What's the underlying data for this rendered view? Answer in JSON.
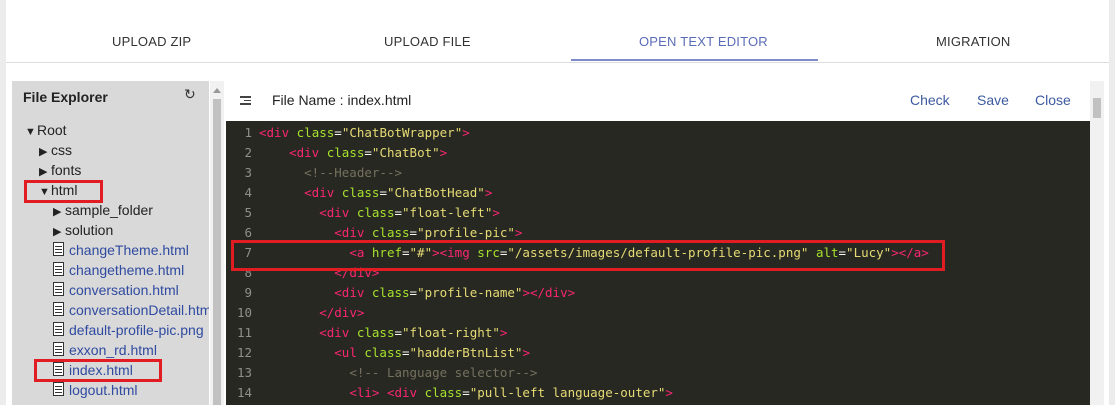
{
  "tabs": [
    {
      "label": "UPLOAD ZIP"
    },
    {
      "label": "UPLOAD FILE"
    },
    {
      "label": "OPEN TEXT EDITOR",
      "active": true
    },
    {
      "label": "MIGRATION"
    }
  ],
  "explorer": {
    "title": "File Explorer",
    "refresh_icon": "refresh-icon",
    "tree": [
      {
        "label": "Root",
        "type": "folder",
        "expanded": true
      },
      {
        "label": "css",
        "type": "folder"
      },
      {
        "label": "fonts",
        "type": "folder"
      },
      {
        "label": "html",
        "type": "folder",
        "expanded": true,
        "highlighted": true
      },
      {
        "label": "sample_folder",
        "type": "folder"
      },
      {
        "label": "solution",
        "type": "folder"
      },
      {
        "label": "changeTheme.html",
        "type": "file"
      },
      {
        "label": "changetheme.html",
        "type": "file"
      },
      {
        "label": "conversation.html",
        "type": "file"
      },
      {
        "label": "conversationDetail.htm",
        "type": "file"
      },
      {
        "label": "default-profile-pic.png",
        "type": "file"
      },
      {
        "label": "exxon_rd.html",
        "type": "file"
      },
      {
        "label": "index.html",
        "type": "file",
        "highlighted": true
      },
      {
        "label": "logout.html",
        "type": "file"
      }
    ]
  },
  "editor": {
    "file_label": "File Name :  index.html",
    "check": "Check",
    "save": "Save",
    "close": "Close",
    "lines": [
      {
        "n": "1",
        "ind": "",
        "parts": [
          [
            "tg",
            "<div "
          ],
          [
            "at",
            "class"
          ],
          [
            "pu",
            "="
          ],
          [
            "st",
            "\"ChatBotWrapper\""
          ],
          [
            "tg",
            ">"
          ]
        ]
      },
      {
        "n": "2",
        "ind": "    ",
        "parts": [
          [
            "tg",
            "<div "
          ],
          [
            "at",
            "class"
          ],
          [
            "pu",
            "="
          ],
          [
            "st",
            "\"ChatBot\""
          ],
          [
            "tg",
            ">"
          ]
        ]
      },
      {
        "n": "3",
        "ind": "      ",
        "parts": [
          [
            "cm",
            "<!--Header-->"
          ]
        ]
      },
      {
        "n": "4",
        "ind": "      ",
        "parts": [
          [
            "tg",
            "<div "
          ],
          [
            "at",
            "class"
          ],
          [
            "pu",
            "="
          ],
          [
            "st",
            "\"ChatBotHead\""
          ],
          [
            "tg",
            ">"
          ]
        ]
      },
      {
        "n": "5",
        "ind": "        ",
        "parts": [
          [
            "tg",
            "<div "
          ],
          [
            "at",
            "class"
          ],
          [
            "pu",
            "="
          ],
          [
            "st",
            "\"float-left\""
          ],
          [
            "tg",
            ">"
          ]
        ]
      },
      {
        "n": "6",
        "ind": "          ",
        "parts": [
          [
            "tg",
            "<div "
          ],
          [
            "at",
            "class"
          ],
          [
            "pu",
            "="
          ],
          [
            "st",
            "\"profile-pic\""
          ],
          [
            "tg",
            ">"
          ]
        ]
      },
      {
        "n": "7",
        "ind": "            ",
        "parts": [
          [
            "tg",
            "<a "
          ],
          [
            "at",
            "href"
          ],
          [
            "pu",
            "="
          ],
          [
            "st",
            "\"#\""
          ],
          [
            "tg",
            "><img "
          ],
          [
            "at",
            "src"
          ],
          [
            "pu",
            "="
          ],
          [
            "st",
            "\"/assets/images/default-profile-pic.png\""
          ],
          [
            "pu",
            " "
          ],
          [
            "at",
            "alt"
          ],
          [
            "pu",
            "="
          ],
          [
            "st",
            "\"Lucy\""
          ],
          [
            "tg",
            "></a>"
          ]
        ]
      },
      {
        "n": "8",
        "ind": "          ",
        "parts": [
          [
            "tg",
            "</div>"
          ]
        ]
      },
      {
        "n": "9",
        "ind": "          ",
        "parts": [
          [
            "tg",
            "<div "
          ],
          [
            "at",
            "class"
          ],
          [
            "pu",
            "="
          ],
          [
            "st",
            "\"profile-name\""
          ],
          [
            "tg",
            "></div>"
          ]
        ]
      },
      {
        "n": "10",
        "ind": "        ",
        "parts": [
          [
            "tg",
            "</div>"
          ]
        ]
      },
      {
        "n": "11",
        "ind": "        ",
        "parts": [
          [
            "tg",
            "<div "
          ],
          [
            "at",
            "class"
          ],
          [
            "pu",
            "="
          ],
          [
            "st",
            "\"float-right\""
          ],
          [
            "tg",
            ">"
          ]
        ]
      },
      {
        "n": "12",
        "ind": "          ",
        "parts": [
          [
            "tg",
            "<ul "
          ],
          [
            "at",
            "class"
          ],
          [
            "pu",
            "="
          ],
          [
            "st",
            "\"hadderBtnList\""
          ],
          [
            "tg",
            ">"
          ]
        ]
      },
      {
        "n": "13",
        "ind": "            ",
        "parts": [
          [
            "cm",
            "<!-- Language selector-->"
          ]
        ]
      },
      {
        "n": "14",
        "ind": "            ",
        "parts": [
          [
            "tg",
            "<li> <div "
          ],
          [
            "at",
            "class"
          ],
          [
            "pu",
            "="
          ],
          [
            "st",
            "\"pull-left language-outer\""
          ],
          [
            "tg",
            ">"
          ]
        ]
      }
    ]
  },
  "colors": {
    "accent": "#5b6cb8",
    "highlight_box": "#e11d23",
    "editor_bg": "#272822"
  }
}
